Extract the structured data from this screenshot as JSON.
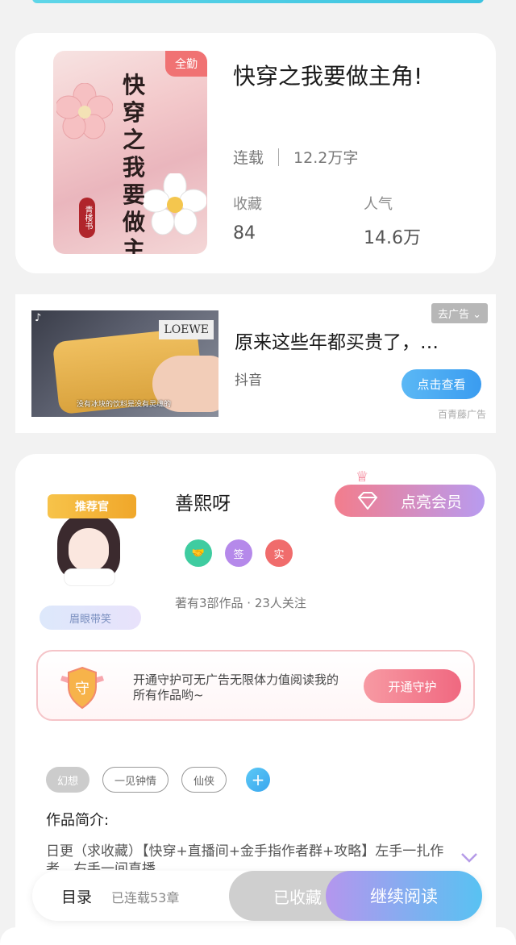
{
  "book": {
    "badge": "全勤",
    "cover_title": "快穿之我要做主角",
    "cover_seal": "青楼书",
    "title": "快穿之我要做主角!",
    "status": "连载",
    "word_count": "12.2万字",
    "favorites_label": "收藏",
    "favorites_value": "84",
    "popularity_label": "人气",
    "popularity_value": "14.6万"
  },
  "ad": {
    "remove_label": "去广告",
    "title": "原来这些年都买贵了，…",
    "source": "抖音",
    "cta": "点击查看",
    "brand": "百青藤广告",
    "image_sign": "LOEWE",
    "image_caption": "没有冰块的饮料是没有灵魂的"
  },
  "author": {
    "ribbon": "推荐官",
    "tag": "眉眼带笑",
    "name": "善熙呀",
    "vip_button": "点亮会员",
    "badge_sign": "签",
    "badge_real": "实",
    "stats": "著有3部作品 · 23人关注"
  },
  "guard": {
    "text": "开通守护可无广告无限体力值阅读我的所有作品哟~",
    "shield_char": "守",
    "button": "开通守护"
  },
  "tags": [
    "幻想",
    "一见钟情",
    "仙侠"
  ],
  "tag_add": "+",
  "intro": {
    "label": "作品简介:",
    "text": "日更（求收藏）【快穿+直播间+金手指作者群+攻略】左手一扎作者，右手一间直播，…"
  },
  "bottom": {
    "toc": "目录",
    "chapters": "已连载53章",
    "favorited": "已收藏",
    "continue": "继续阅读"
  },
  "colors": {
    "accent_blue": "#3a9cf0",
    "accent_pink": "#f06880",
    "badge_red": "#f07273"
  }
}
